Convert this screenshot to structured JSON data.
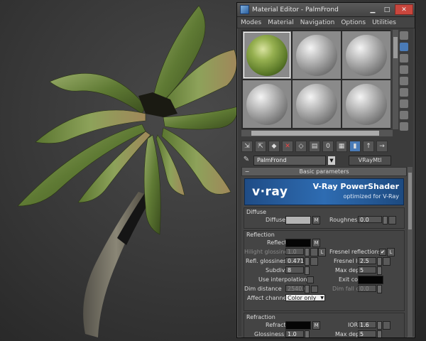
{
  "window": {
    "title": "Material Editor - PalmFrond",
    "minimize": "▁",
    "maximize": "□",
    "close": "✕"
  },
  "menu": [
    "Modes",
    "Material",
    "Navigation",
    "Options",
    "Utilities"
  ],
  "material": {
    "name": "PalmFrond",
    "type": "VRayMtl"
  },
  "rollout": {
    "title": "Basic parameters",
    "minus": "−"
  },
  "banner": {
    "logo": "v·ray",
    "product": "V-Ray PowerShader",
    "subtitle": "optimized for V-Ray"
  },
  "diffuse": {
    "group": "Diffuse",
    "diffuse_label": "Diffuse",
    "m": "M",
    "roughness_label": "Roughness",
    "roughness_value": "0.0"
  },
  "reflection": {
    "group": "Reflection",
    "reflect_label": "Reflect",
    "m": "M",
    "l": "L",
    "hilight_label": "Hilight glossiness",
    "hilight_value": "1.0",
    "fresnel_label": "Fresnel reflections",
    "fresnel_checked": "✔",
    "refl_gloss_label": "Refl. glossiness",
    "refl_gloss_value": "0.471",
    "fresnel_ior_label": "Fresnel IOR",
    "fresnel_ior_value": "2.5",
    "subdivs_label": "Subdivs",
    "subdivs_value": "8",
    "max_depth_label": "Max depth",
    "max_depth_value": "5",
    "interp_label": "Use interpolation",
    "exit_color_label": "Exit color",
    "dim_distance_label": "Dim distance",
    "dim_distance_value": "2540.0",
    "dim_falloff_label": "Dim fall off",
    "dim_falloff_value": "0.0",
    "affect_label": "Affect channels",
    "affect_value": "Color only"
  },
  "refraction": {
    "group": "Refraction",
    "refract_label": "Refract",
    "m": "M",
    "ior_label": "IOR",
    "ior_value": "1.6",
    "glossiness_label": "Glossiness",
    "glossiness_value": "1.0",
    "max_depth_label": "Max depth",
    "max_depth_value": "5"
  },
  "colors": {
    "diffuse_swatch": "#b4b4b4",
    "reflect_swatch": "#050505",
    "exit_swatch": "#050505",
    "refract_swatch": "#050505",
    "leaf_green": "#6f8a3a",
    "trunk": "#6e6a5c",
    "close_red": "#c9463d"
  }
}
